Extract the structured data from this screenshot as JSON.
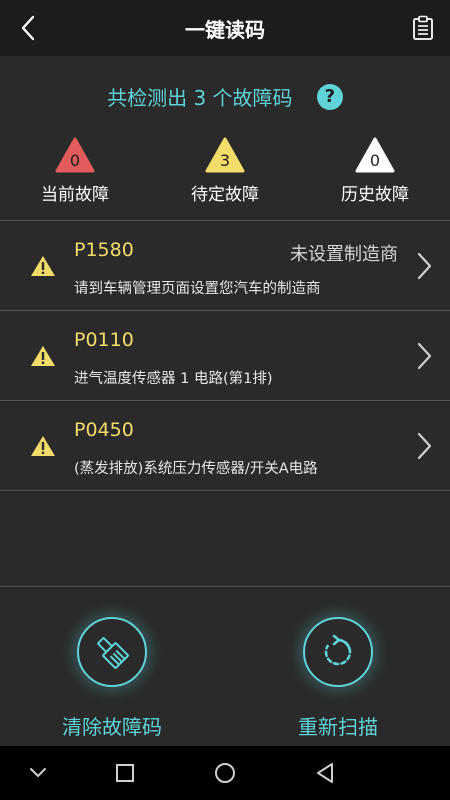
{
  "header": {
    "title": "一键读码",
    "back_icon": "chevron-left-icon",
    "report_icon": "clipboard-icon"
  },
  "summary": {
    "detect_text": "共检测出 3 个故障码",
    "help_glyph": "?",
    "counts": [
      {
        "value": "0",
        "label": "当前故障",
        "color": "#e35b5b"
      },
      {
        "value": "3",
        "label": "待定故障",
        "color": "#f3dc6a"
      },
      {
        "value": "0",
        "label": "历史故障",
        "color": "#ffffff"
      }
    ]
  },
  "faults": [
    {
      "code": "P1580",
      "maker": "未设置制造商",
      "desc": "请到车辆管理页面设置您汽车的制造商"
    },
    {
      "code": "P0110",
      "maker": "",
      "desc": "进气温度传感器 1 电路(第1排)"
    },
    {
      "code": "P0450",
      "maker": "",
      "desc": "(蒸发排放)系统压力传感器/开关A电路"
    }
  ],
  "actions": {
    "clear_label": "清除故障码",
    "rescan_label": "重新扫描"
  },
  "colors": {
    "accent": "#5fd3d8",
    "warning": "#f3dc6a",
    "error": "#e35b5b",
    "background": "#2a2a2a",
    "header": "#1c1c1c"
  }
}
